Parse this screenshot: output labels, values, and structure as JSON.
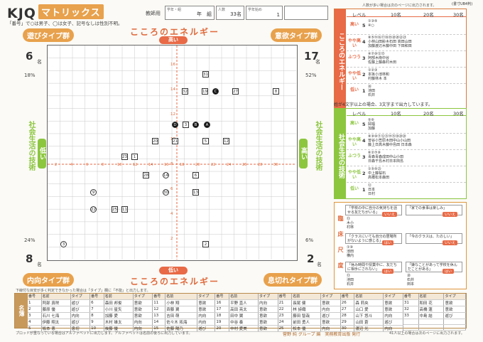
{
  "header": {
    "logo": "KJQ",
    "logo_kata": "マトリックス",
    "teacher_label": "教師用",
    "note": "「番号」で○は男子、◯は女子、記号なしは性別不明。",
    "fields": [
      {
        "label": "学年・組",
        "value": "年　組"
      },
      {
        "label": "人数",
        "value": "33名"
      },
      {
        "label": "学年始め",
        "value": "1"
      }
    ],
    "page_note": "(書寸UB4判)"
  },
  "matrix": {
    "top_title": "こころのエネルギー",
    "top_sub": "高い",
    "bottom_title": "こころのエネルギー",
    "bottom_sub": "低い",
    "left_title": "社会生活の技術",
    "left_sub": "低い",
    "right_title": "社会生活の技術",
    "right_sub": "高い",
    "groups": {
      "tl": "遊びタイプ群",
      "tr": "意欲タイプ群",
      "bl": "内向タイプ群",
      "br": "息切れタイプ群"
    },
    "counts": {
      "tl": "6",
      "tr": "17",
      "bl": "8",
      "br": "2"
    },
    "count_unit": "名",
    "pcts": {
      "tl": "18",
      "tr": "52",
      "bl": "24",
      "br": "6"
    },
    "pct_unit": "%",
    "y_ticks": [
      "16",
      "14",
      "12",
      "10",
      "8",
      "6",
      "4",
      "2"
    ],
    "x_ticks": [
      "2",
      "4",
      "6",
      "8",
      "10",
      "12",
      "14",
      "16",
      "18",
      "20",
      "22",
      "24",
      "26",
      "28",
      "30"
    ],
    "markers": [
      {
        "l": "31",
        "c": 0
      },
      {
        "l": "32",
        "c": 0
      },
      {
        "l": "19",
        "c": 0
      },
      {
        "l": "C",
        "c": 2
      },
      {
        "l": "27",
        "c": 0
      },
      {
        "l": "8",
        "c": 0
      },
      {
        "l": "D",
        "c": 2
      },
      {
        "l": "3",
        "c": 0
      },
      {
        "l": "B",
        "c": 2
      },
      {
        "l": "A",
        "c": 2
      },
      {
        "l": "20",
        "c": 0
      },
      {
        "l": "21",
        "c": 0
      },
      {
        "l": "5",
        "c": 0
      },
      {
        "l": "12",
        "c": 0
      },
      {
        "l": "23",
        "c": 0
      },
      {
        "l": "1",
        "c": 0
      },
      {
        "l": "28",
        "c": 0
      },
      {
        "l": "14",
        "c": 1
      },
      {
        "l": "6",
        "c": 0
      },
      {
        "l": "9",
        "c": 1
      },
      {
        "l": "30",
        "c": 1
      },
      {
        "l": "13",
        "c": 0
      },
      {
        "l": "22",
        "c": 1
      },
      {
        "l": "25",
        "c": 0
      },
      {
        "l": "11",
        "c": 0
      },
      {
        "l": "3",
        "c": 1
      },
      {
        "l": "2",
        "c": 0
      }
    ]
  },
  "energy_panel": {
    "title": "こころのエネルギー",
    "note": "人数が多い場合は次のページに出力されます。",
    "scale": [
      "10名",
      "20名",
      "30名"
    ],
    "level_label": "レベル",
    "rows": [
      {
        "label": "高い",
        "n": "5",
        "names": "①③⑤\n④○"
      },
      {
        "label": "やや高い",
        "n": "4",
        "names": "⑧⑤⑭⑯⑰⑱⑲⑳⑳㉒㉓\n小林山田鈴木石田 高田山田\n加藤渡辺木藤中田 下田和田"
      },
      {
        "label": "ふつう",
        "n": "3",
        "names": "④⑦⑩⑫⑮\n阿部木南中谷\n佐藤上藤森村木田"
      },
      {
        "label": "やや低い",
        "n": "2",
        "names": "①②③\n本坂小池林和\n村藤林木 本"
      },
      {
        "label": "低い",
        "n": "1",
        "names": "㉖\n池田\n石井"
      }
    ],
    "footer": "姓が4文字以上の場合、3文字まで出力しています。"
  },
  "skill_panel": {
    "title": "社会生活の技術",
    "rows": [
      {
        "label": "高い",
        "n": "5",
        "names": "⑤⑥\n岡福\n加藤"
      },
      {
        "label": "やや高い",
        "n": "4",
        "names": "⑧⑨⑩⑪⑫⑬⑭⑮⑱⑳⑳\n曽谷小笠原木田中山小山田\n藤上日高木藤中島田 日本森"
      },
      {
        "label": "ふつう",
        "n": "3",
        "names": "⑥②⑦⑧\n青森青森成田中山小田\n日森干島木村日本田島"
      },
      {
        "label": "やや低い",
        "n": "2",
        "names": "①⑤⑤㉕\n中上藤桜石\n高橋松本森田"
      },
      {
        "label": "低い",
        "n": "1",
        "names": "⑫\n日本\n日村"
      }
    ]
  },
  "clinical": {
    "title": "臨床尺度",
    "items": [
      {
        "q": "「学校の中に自分の気持ちを話せる友だちがいる」",
        "a": "いいえ",
        "names": "⑬\n木小\n村林"
      },
      {
        "q": "「家での食事は楽しみ」",
        "a": "いいえ",
        "names": ""
      },
      {
        "q": "「クラスにいても自分の居場所がないように感じる」",
        "a": "はい",
        "names": "①⑩\n池田\n横内"
      },
      {
        "q": "「今のクラスは、たのしい」",
        "a": "いいえ",
        "names": ""
      },
      {
        "q": "「休み時間や授業中に、友だちに相手にされない」",
        "a": "はい",
        "names": "⑬\n池田\n石井"
      },
      {
        "q": "「嫌なことがあって学校を休んだことがある」",
        "a": "はい",
        "names": "⑳\n石井\n田本"
      }
    ]
  },
  "roster": {
    "title": "名簿",
    "note": "下線付な目安が多く判定できなかった場合は「タイプ」欄に「不能」と出力します。",
    "cols": [
      "番号",
      "名前",
      "タイプ"
    ],
    "entries": [
      [
        "1",
        "阿部 真咲",
        "遊び"
      ],
      [
        "2",
        "藤原 優",
        "遊び"
      ],
      [
        "3",
        "石川 七海",
        "内向"
      ],
      [
        "4",
        "伊藤 翔太",
        "遊び"
      ],
      [
        "5",
        "坂本 恵",
        "息切"
      ],
      [
        "6",
        "森田 邦俊",
        "意欲"
      ],
      [
        "7",
        "小川 星矢",
        "意欲"
      ],
      [
        "8",
        "加藤 愛",
        "意欲"
      ],
      [
        "9",
        "木村 雄太",
        "内向"
      ],
      [
        "10",
        "後藤 優",
        "内向"
      ],
      [
        "11",
        "小林 翔",
        "意欲"
      ],
      [
        "12",
        "斉藤 翼",
        "意欲"
      ],
      [
        "13",
        "吉田 萌",
        "内向"
      ],
      [
        "14",
        "佐々木 拓海",
        "内向"
      ],
      [
        "15",
        "佐藤 陽乃",
        "遊び"
      ],
      [
        "16",
        "平野 直人",
        "内向"
      ],
      [
        "17",
        "高田 亮太",
        "意欲"
      ],
      [
        "18",
        "田中 翼",
        "意欲"
      ],
      [
        "19",
        "中谷 奏",
        "意欲"
      ],
      [
        "20",
        "中村 愛美",
        "意欲"
      ],
      [
        "21",
        "長尾 健",
        "意欲"
      ],
      [
        "22",
        "林 詩織",
        "内向"
      ],
      [
        "23",
        "藤田 智哉",
        "遊び"
      ],
      [
        "24",
        "前田 勇人",
        "意欲"
      ],
      [
        "25",
        "松本 優",
        "内向"
      ],
      [
        "26",
        "森 莉央",
        "意欲"
      ],
      [
        "27",
        "山口 愛",
        "意欲"
      ],
      [
        "28",
        "山下 悠斗",
        "内向"
      ],
      [
        "29",
        "山田 蒼",
        "遊び"
      ],
      [
        "30",
        "渡辺 光",
        "内向"
      ],
      [
        "31",
        "和田 花",
        "意欲"
      ],
      [
        "32",
        "高橋 蓮",
        "意欲"
      ],
      [
        "33",
        "中島 結",
        "遊び"
      ]
    ],
    "footer_left": "プロットが重なっている場合はアルファベットに出力します。アルファベットは名前の後ろに出力しています。",
    "footer_center": "菅野 純 グループ 編　実務教育出版 発行",
    "footer_right": "41人以上の場合は次のページに出力されます。"
  },
  "colors": {
    "orange": "#e86a46",
    "green": "#8cc63f",
    "tan": "#e8a14c"
  }
}
